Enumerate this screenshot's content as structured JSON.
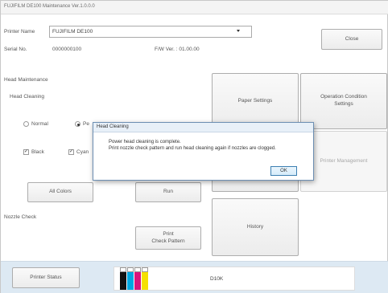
{
  "window": {
    "title": "FUJIFILM DE100 Maintenance Ver.1.0.0.0"
  },
  "header": {
    "printer_name_label": "Printer Name",
    "printer_name_value": "FUJIFILM DE100",
    "serial_label": "Serial No.",
    "serial_value": "0000000100",
    "fw_label": "F/W Ver. : 01.00.00",
    "close_label": "Close"
  },
  "head_maintenance": {
    "section_label": "Head Maintenance",
    "cleaning_label": "Head Cleaning",
    "mode_normal": "Normal",
    "mode_power_partial": "Pe",
    "mode_selected": "Power",
    "black_label": "Black",
    "cyan_partial": "Cyan",
    "all_colors_label": "All Colors",
    "run_label": "Run"
  },
  "nozzle_check": {
    "section_label": "Nozzle Check",
    "print_label": "Print\nCheck Pattern"
  },
  "right_panel": {
    "paper_settings": "Paper Settings",
    "operation_condition": "Operation Condition\nSettings",
    "printer_management": "Printer Management",
    "history": "History"
  },
  "status": {
    "printer_status_label": "Printer Status",
    "model_text": "D10K",
    "ink_colors": [
      "#111111",
      "#00a6e0",
      "#d8147c",
      "#f5e000"
    ]
  },
  "dialog": {
    "title": "Head Cleaning",
    "line1": "Power head cleaning is complete.",
    "line2": "Print nozzle check pattern and run head cleaning again if nozzles are clogged.",
    "ok_label": "OK"
  }
}
